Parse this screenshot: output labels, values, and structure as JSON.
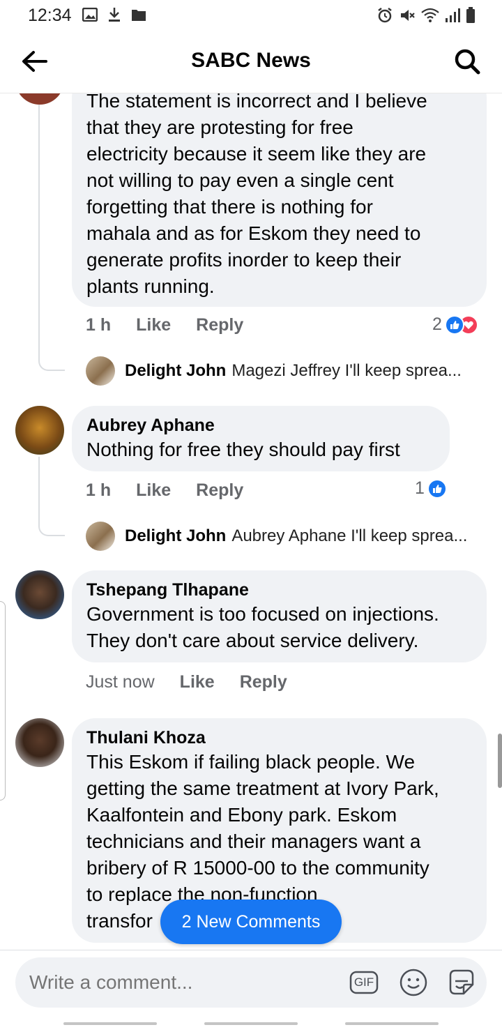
{
  "status_bar": {
    "time": "12:34",
    "left_icons": [
      "image-icon",
      "download-icon",
      "folder-icon"
    ],
    "right_icons": [
      "alarm-icon",
      "mute-icon",
      "wifi-icon",
      "signal-icon",
      "battery-icon"
    ]
  },
  "header": {
    "title": "SABC News"
  },
  "comments": [
    {
      "text_lines": [
        "The statement is incorrect and I believe",
        "that they are protesting for free",
        "electricity because it seem like they are",
        "not willing to pay even a single cent",
        "forgetting that there is nothing for",
        "mahala and as for Eskom they need to",
        "generate profits inorder to keep their",
        "plants running."
      ],
      "time": "1 h",
      "like_label": "Like",
      "reply_label": "Reply",
      "reaction_count": "2",
      "reply": {
        "name": "Delight John",
        "snippet": "Magezi Jeffrey  I'll keep sprea..."
      }
    },
    {
      "author": "Aubrey Aphane",
      "text_lines": [
        "Nothing for free they should pay first"
      ],
      "time": "1 h",
      "like_label": "Like",
      "reply_label": "Reply",
      "reaction_count": "1",
      "reply": {
        "name": "Delight John",
        "snippet": "Aubrey Aphane  I'll keep sprea..."
      }
    },
    {
      "author": "Tshepang Tlhapane",
      "text_lines": [
        "Government is too focused on injections.",
        "They don't care about service delivery."
      ],
      "time": "Just now",
      "like_label": "Like",
      "reply_label": "Reply"
    },
    {
      "author": "Thulani Khoza",
      "text_lines": [
        "This Eskom if failing black people. We",
        "getting the same treatment at Ivory Park,",
        "Kaalfontein and Ebony park. Eskom",
        "technicians and their managers want a",
        "bribery of R 15000-00 to the community",
        "to replace the non-function",
        "transfor"
      ]
    }
  ],
  "new_comments_label": "2 New Comments",
  "composer": {
    "placeholder": "Write a comment...",
    "gif_label": "GIF"
  },
  "colors": {
    "accent": "#1877f2",
    "bubble": "#f0f2f5",
    "meta": "#65676b",
    "love": "#f33e58"
  }
}
